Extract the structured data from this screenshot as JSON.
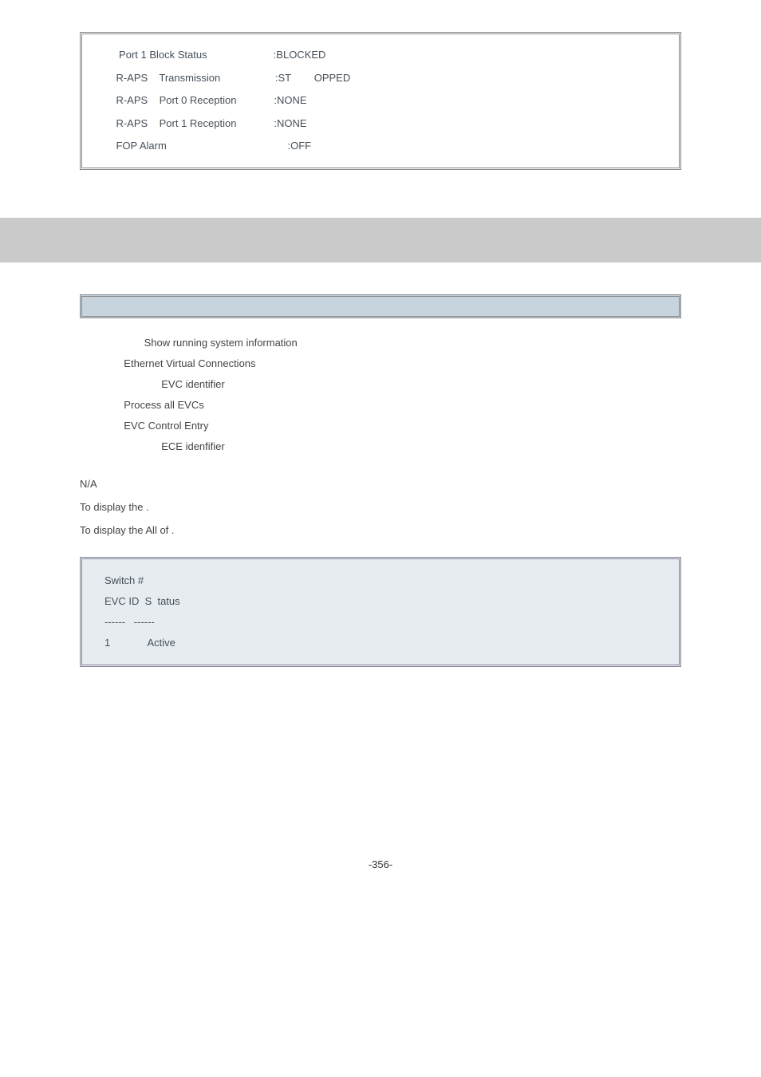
{
  "box1": {
    "r1": "     Port 1 Block Status                       :BLOCKED",
    "r2": "    R-APS    Transmission                   :ST        OPPED",
    "r3": "    R-APS    Port 0 Reception             :NONE",
    "r4": "    R-APS    Port 1 Reception             :NONE",
    "r5": "    FOP Alarm                                          :OFF"
  },
  "desc": {
    "l1": "              Show running system information",
    "l2": "       Ethernet Virtual Connections",
    "l3": "                    EVC identifier",
    "l4": "       Process all EVCs",
    "l5": "       EVC Control Entry",
    "l6": "                    ECE idenfifier"
  },
  "labels": {
    "na": "N/A",
    "s1": "To display the                     .",
    "s2": "To display the All of                       ."
  },
  "box2": {
    "r1": "Switch #",
    "r2": "EVC ID  S  tatus",
    "r3": "------   ------",
    "r4": "1             Active"
  },
  "pagenum": "-356-"
}
